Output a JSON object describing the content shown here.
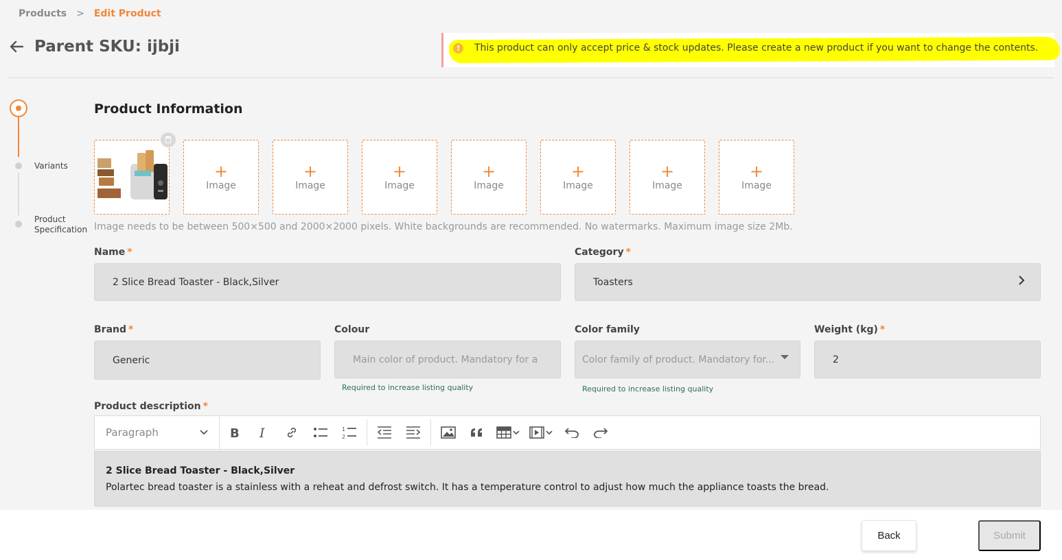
{
  "breadcrumb": {
    "parent": "Products",
    "separator": ">",
    "current": "Edit Product"
  },
  "header": {
    "title": "Parent SKU: ijbji"
  },
  "notice": {
    "text": "This product can only accept price & stock updates. Please create a new product if you want to change the contents.",
    "icon": "warning-icon"
  },
  "stepper": {
    "steps": [
      "",
      "Variants",
      "Product Specification"
    ]
  },
  "section": {
    "title": "Product Information"
  },
  "images": {
    "slot_label": "Image",
    "plus": "+",
    "count": 7,
    "help": "Image needs to be between 500×500 and 2000×2000 pixels. White backgrounds are recommended. No watermarks. Maximum image size 2Mb."
  },
  "form": {
    "name": {
      "label": "Name",
      "value": "2 Slice Bread Toaster - Black,Silver",
      "required": "*"
    },
    "category": {
      "label": "Category",
      "value": "Toasters",
      "required": "*"
    },
    "brand": {
      "label": "Brand",
      "value": "Generic",
      "required": "*"
    },
    "colour": {
      "label": "Colour",
      "placeholder": "Main color of product. Mandatory for a",
      "hint": "Required to increase listing quality"
    },
    "color_family": {
      "label": "Color family",
      "placeholder": "Color family of product. Mandatory for...",
      "hint": "Required to increase listing quality"
    },
    "weight": {
      "label": "Weight (kg)",
      "value": "2",
      "required": "*"
    },
    "description": {
      "label": "Product description",
      "required": "*",
      "heading": "2 Slice Bread Toaster - Black,Silver",
      "body": "Polartec bread toaster is a stainless with a reheat and defrost switch. It has a temperature control to adjust how much the appliance toasts the bread."
    }
  },
  "toolbar": {
    "paragraph": "Paragraph"
  },
  "footer": {
    "back_label": "Back",
    "submit_label": "Submit"
  },
  "colors": {
    "accent": "#f0883a",
    "highlight": "#ffff00"
  }
}
